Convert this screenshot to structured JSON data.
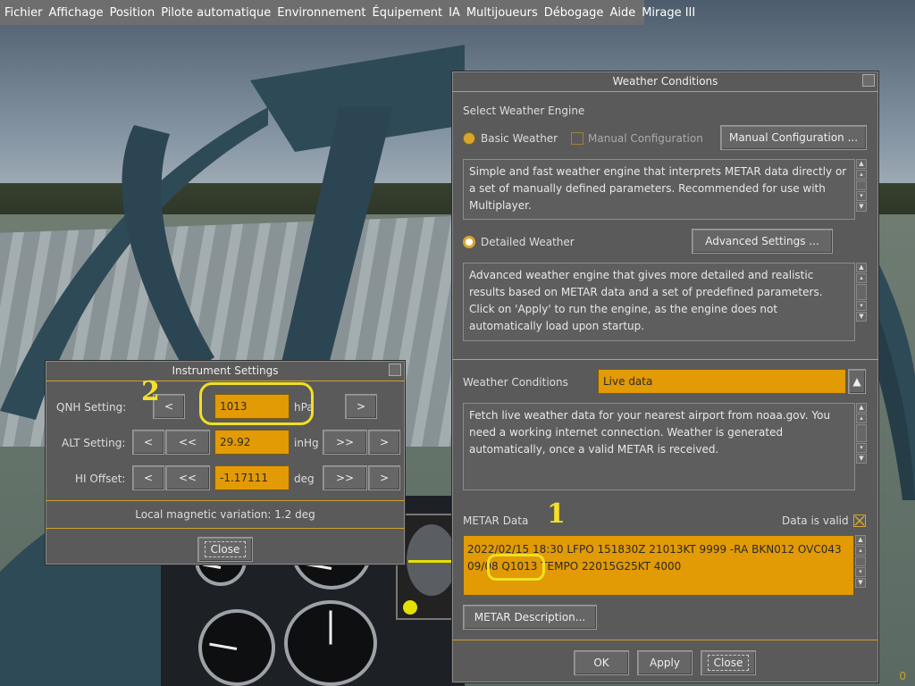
{
  "menubar": {
    "items": [
      "Fichier",
      "Affichage",
      "Position",
      "Pilote automatique",
      "Environnement",
      "Équipement",
      "IA",
      "Multijoueurs",
      "Débogage",
      "Aide",
      "Mirage III"
    ]
  },
  "weather": {
    "title": "Weather Conditions",
    "engine_heading": "Select Weather Engine",
    "basic_label": "Basic Weather",
    "manual_config_checkbox_label": "Manual Configuration",
    "manual_config_button": "Manual Configuration ...",
    "basic_description": "Simple and fast weather engine that interprets METAR data directly or a set of manually defined parameters. Recommended for use with Multiplayer.",
    "detailed_label": "Detailed Weather",
    "advanced_button": "Advanced Settings ...",
    "detailed_description": "Advanced weather engine that gives more detailed and realistic results based on METAR data and a set of predefined parameters. Click on 'Apply' to run the engine, as the engine does not automatically load upon startup.",
    "conditions_label": "Weather Conditions",
    "conditions_value": "Live data",
    "conditions_description": "Fetch live weather data for your nearest airport from noaa.gov. You need a working internet connection. Weather is generated automatically, once a valid METAR is received.",
    "metar_label": "METAR Data",
    "valid_label": "Data is valid",
    "metar_text": "2022/02/15 18:30 LFPO 151830Z 21013KT 9999 -RA BKN012 OVC043 09/08 Q1013 TEMPO 22015G25KT 4000",
    "metar_desc_button": "METAR Description...",
    "ok": "OK",
    "apply": "Apply",
    "close": "Close"
  },
  "instrument": {
    "title": "Instrument Settings",
    "qnh_label": "QNH Setting:",
    "qnh_value": "1013",
    "qnh_unit": "hPa",
    "alt_label": "ALT Setting:",
    "alt_value": "29.92",
    "alt_unit": "inHg",
    "hi_label": "HI Offset:",
    "hi_value": "-1.17111",
    "hi_unit": "deg",
    "btn_dec": "<",
    "btn_dec_fast": "<<",
    "btn_inc": ">",
    "btn_inc_fast": ">>",
    "magvar": "Local magnetic variation:  1.2 deg",
    "close": "Close"
  },
  "annotations": {
    "one": "1",
    "two": "2"
  },
  "fps": "0",
  "colors": {
    "accent": "#e29a05",
    "separator": "#cfa030",
    "annotation": "#f0e020"
  }
}
